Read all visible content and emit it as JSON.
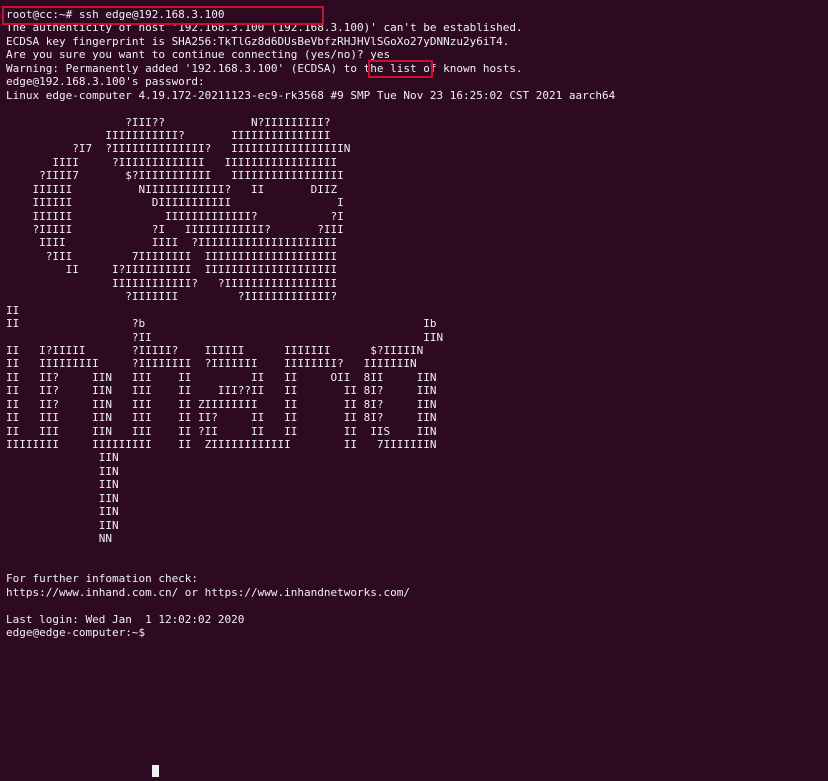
{
  "terminal": {
    "background": "#2d0a22",
    "foreground": "#f1f1f1",
    "highlight_color": "#c8102e",
    "lines": [
      "root@cc:~# ssh edge@192.168.3.100",
      "The authenticity of host '192.168.3.100 (192.168.3.100)' can't be established.",
      "ECDSA key fingerprint is SHA256:TkTlGz8d6DUsBeVbfzRHJHVlSGoXo27yDNNzu2y6iT4.",
      "Are you sure you want to continue connecting (yes/no)? yes",
      "Warning: Permanently added '192.168.3.100' (ECDSA) to the list of known hosts.",
      "edge@192.168.3.100's password:",
      "Linux edge-computer 4.19.172-20211123-ec9-rk3568 #9 SMP Tue Nov 23 16:25:02 CST 2021 aarch64",
      "",
      "                  ?III??             N?IIIIIIIII?",
      "               IIIIIIIIIII?       IIIIIIIIIIIIIII",
      "          ?I7  ?IIIIIIIIIIIIII?   IIIIIIIIIIIIIIIIIN",
      "       IIII     ?IIIIIIIIIIIII   IIIIIIIIIIIIIIIII",
      "     ?IIII7       $?IIIIIIIIIII   IIIIIIIIIIIIIIIII",
      "    IIIIII          NIIIIIIIIIIII?   II       DIIZ",
      "    IIIIII            DIIIIIIIIIII                I",
      "    IIIIII              IIIIIIIIIIIII?           ?I",
      "    ?IIIII            ?I   IIIIIIIIIIII?       ?III",
      "     IIII             IIII  ?IIIIIIIIIIIIIIIIIIIII",
      "      ?III         7IIIIIIII  IIIIIIIIIIIIIIIIIIII",
      "         II     I?IIIIIIIIII  IIIIIIIIIIIIIIIIIIII",
      "                IIIIIIIIIIII?   ?IIIIIIIIIIIIIIIII",
      "                  ?IIIIIII         ?IIIIIIIIIIIII?",
      "II",
      "II                 ?b                                          Ib",
      "                   ?II                                         IIN",
      "II   I?IIIII       ?IIIII?    IIIIII      IIIIIII      $?IIIIIN",
      "II   IIIIIIIII     ?IIIIIIII  ?IIIIIII    IIIIIIII?   IIIIIIIN",
      "II   II?     IIN   III    II         II   II     OII  8II     IIN",
      "II   II?     IIN   III    II    III??II   II       II 8I?     IIN",
      "II   II?     IIN   III    II ZIIIIIIII    II       II 8I?     IIN",
      "II   III     IIN   III    II II?     II   II       II 8I?     IIN",
      "II   III     IIN   III    II ?II     II   II       II  IIS    IIN",
      "IIIIIIII     IIIIIIIII    II  ZIIIIIIIIIIII        II   7IIIIIIIN",
      "              IIN",
      "              IIN",
      "              IIN",
      "              IIN",
      "              IIN",
      "              IIN",
      "              NN",
      "",
      "",
      "For further infomation check:",
      "https://www.inhand.com.cn/ or https://www.inhandnetworks.com/",
      "",
      "Last login: Wed Jan  1 12:02:02 2020",
      "edge@edge-computer:~$ "
    ]
  }
}
